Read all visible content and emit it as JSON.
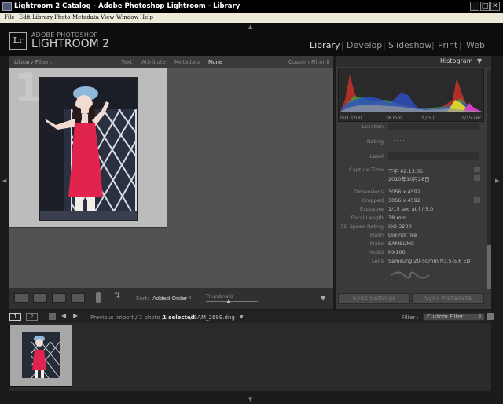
{
  "window": {
    "title": "Lightroom 2 Catalog - Adobe Photoshop Lightroom - Library",
    "buttons": {
      "minimize": "_",
      "maximize": "□",
      "close": "✕"
    }
  },
  "menu": [
    "File",
    "Edit",
    "Library",
    "Photo",
    "Metadata",
    "View",
    "Window",
    "Help"
  ],
  "identity": {
    "logo": "Lr",
    "line1": "ADOBE PHOTOSHOP",
    "line2": "LIGHTROOM 2"
  },
  "modules": [
    "Library",
    "Develop",
    "Slideshow",
    "Print",
    "Web"
  ],
  "module_sep": "|",
  "active_module": "Library",
  "library_filter": {
    "label": "Library Filter :",
    "options": [
      "Text",
      "Attribute",
      "Metadata",
      "None"
    ],
    "active": "None",
    "preset": "Custom Filter"
  },
  "grid": {
    "cell_index": "1"
  },
  "toolbar": {
    "sort_label": "Sort:",
    "sort_value": "Added Order",
    "thumbnails_label": "Thumbnails"
  },
  "histogram": {
    "title": "Histogram",
    "iso": "ISO 3200",
    "focal": "38 mm",
    "aperture": "f / 5.0",
    "shutter": "1/15 sec"
  },
  "metadata": [
    {
      "label": "Location",
      "value": ""
    },
    {
      "label": "Rating",
      "value": "· · · · ·"
    },
    {
      "label": "Label",
      "value": ""
    },
    {
      "label": "Capture Time",
      "value": "下午 02:13:05"
    },
    {
      "label": "",
      "value": "2010年10月28日"
    },
    {
      "label": "Dimensions",
      "value": "3056 x 4592"
    },
    {
      "label": "Cropped",
      "value": "3056 x 4592"
    },
    {
      "label": "Exposure",
      "value": "1/15 sec at f / 5.0"
    },
    {
      "label": "Focal Length",
      "value": "38 mm"
    },
    {
      "label": "ISO Speed Rating",
      "value": "ISO 3200"
    },
    {
      "label": "Flash",
      "value": "Did not fire"
    },
    {
      "label": "Make",
      "value": "SAMSUNG"
    },
    {
      "label": "Model",
      "value": "NX100"
    },
    {
      "label": "Lens",
      "value": "Samsung 20-50mm f/3.5-5.6 ED"
    }
  ],
  "sync": {
    "settings": "Sync Settings",
    "metadata": "Sync Metadata"
  },
  "filmstrip": {
    "page1": "1",
    "page2": "2",
    "breadcrumb_prefix": "Previous Import / 1 photo /",
    "breadcrumb_selected": "1 selected",
    "breadcrumb_file": "/ SAM_2699.dng",
    "filter_label": "Filter :",
    "filter_value": "Custom Filter"
  },
  "colors": {
    "background": "#1b1b1b",
    "panel": "#3a3a3a",
    "grid": "#525252",
    "photo_dress": "#e0244e"
  }
}
